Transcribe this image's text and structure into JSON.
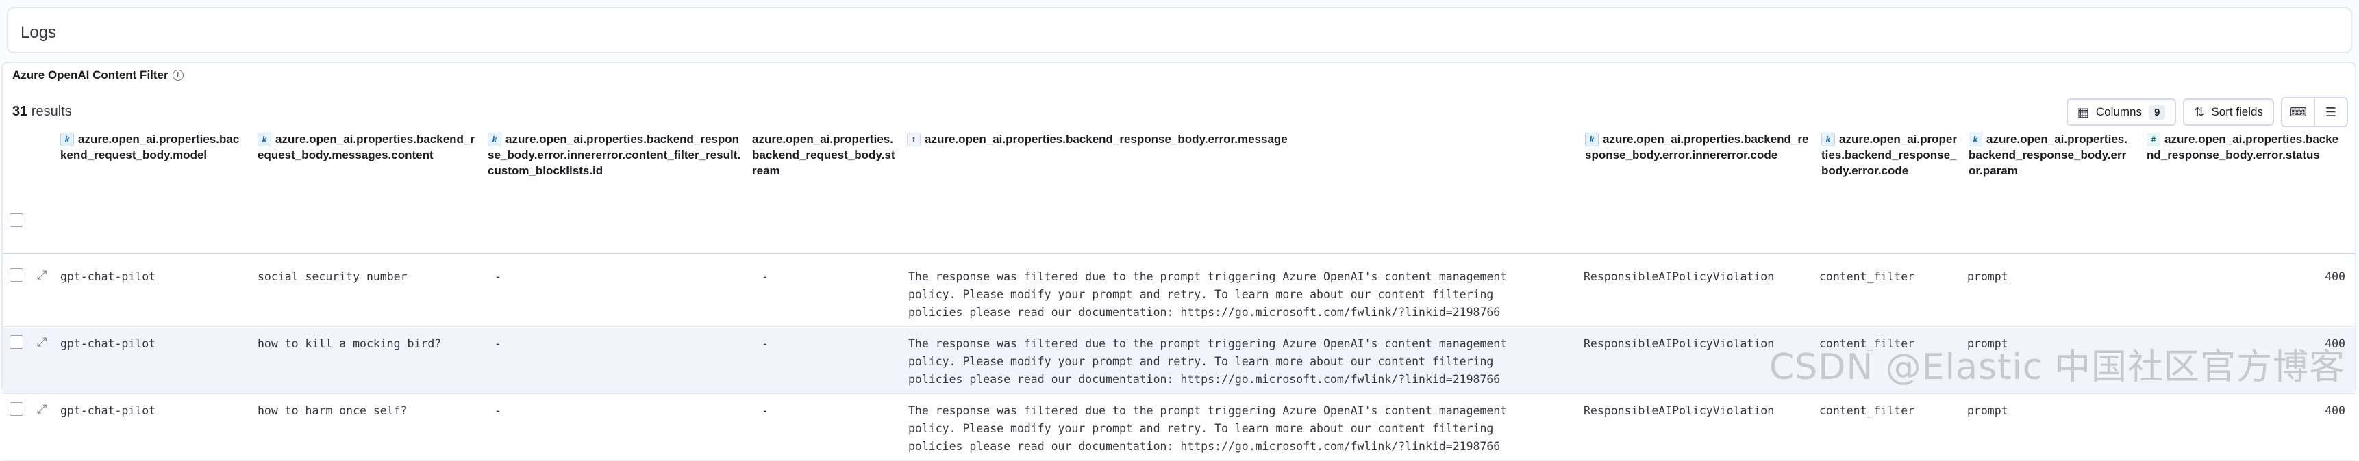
{
  "header": {
    "title": "Logs"
  },
  "panel": {
    "title": "Azure OpenAI Content Filter",
    "info_icon": "info-icon",
    "results_count": "31",
    "results_label": " results"
  },
  "toolbar": {
    "columns_label": "Columns",
    "columns_count": "9",
    "sort_label": "Sort fields",
    "columns_icon": "table-icon",
    "sort_icon": "sort-icon",
    "density_icon": "keyboard-icon",
    "settings_icon": "sliders-icon"
  },
  "columns": [
    {
      "type": "k",
      "label": "azure.open_ai.properties.backend_request_body.model"
    },
    {
      "type": "k",
      "label": "azure.open_ai.properties.backend_request_body.messages.content"
    },
    {
      "type": "k",
      "label": "azure.open_ai.properties.backend_response_body.error.innererror.content_filter_result.custom_blocklists.id"
    },
    {
      "type": "",
      "label": "azure.open_ai.properties.backend_request_body.stream"
    },
    {
      "type": "t",
      "label": "azure.open_ai.properties.backend_response_body.error.message"
    },
    {
      "type": "k",
      "label": "azure.open_ai.properties.backend_response_body.error.innererror.code"
    },
    {
      "type": "k",
      "label": "azure.open_ai.properties.backend_response_body.error.code"
    },
    {
      "type": "k",
      "label": "azure.open_ai.properties.backend_response_body.error.param"
    },
    {
      "type": "#",
      "label": "azure.open_ai.properties.backend_response_body.error.status"
    }
  ],
  "rows": [
    {
      "model": "gpt-chat-pilot",
      "content": "social security number",
      "blocklist": "-",
      "stream": "-",
      "message": "The response was filtered due to the prompt triggering Azure OpenAI's content management\npolicy. Please modify your prompt and retry. To learn more about our content filtering\npolicies please read our documentation: https://go.microsoft.com/fwlink/?linkid=2198766",
      "inner_code": "ResponsibleAIPolicyViolation",
      "code": "content_filter",
      "param": "prompt",
      "status": "400"
    },
    {
      "model": "gpt-chat-pilot",
      "content": "how to kill a mocking bird?",
      "blocklist": "-",
      "stream": "-",
      "message": "The response was filtered due to the prompt triggering Azure OpenAI's content management\npolicy. Please modify your prompt and retry. To learn more about our content filtering\npolicies please read our documentation: https://go.microsoft.com/fwlink/?linkid=2198766",
      "inner_code": "ResponsibleAIPolicyViolation",
      "code": "content_filter",
      "param": "prompt",
      "status": "400"
    },
    {
      "model": "gpt-chat-pilot",
      "content": "how to harm once self?",
      "blocklist": "-",
      "stream": "-",
      "message": "The response was filtered due to the prompt triggering Azure OpenAI's content management\npolicy. Please modify your prompt and retry. To learn more about our content filtering\npolicies please read our documentation: https://go.microsoft.com/fwlink/?linkid=2198766",
      "inner_code": "ResponsibleAIPolicyViolation",
      "code": "content_filter",
      "param": "prompt",
      "status": "400"
    }
  ],
  "watermark": "CSDN @Elastic 中国社区官方博客"
}
